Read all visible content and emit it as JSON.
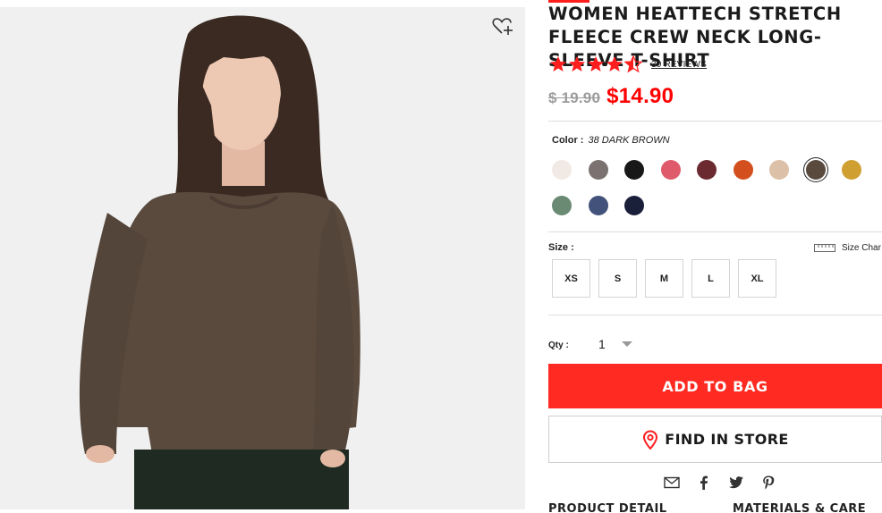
{
  "product": {
    "title": "WOMEN HEATTECH STRETCH FLEECE CREW NECK LONG-SLEEVE T-SHIRT",
    "rating": 4.5,
    "reviews_label": "30 REVIEWS",
    "original_price": "$ 19.90",
    "sale_price": "$14.90"
  },
  "color": {
    "label": "Color :",
    "selected_name": "38 DARK BROWN",
    "swatches": [
      {
        "hex": "#f1e9e4"
      },
      {
        "hex": "#7a7170"
      },
      {
        "hex": "#181818"
      },
      {
        "hex": "#df5b6b"
      },
      {
        "hex": "#6a2a30"
      },
      {
        "hex": "#d3501e"
      },
      {
        "hex": "#dcc0a8"
      },
      {
        "hex": "#5a4a3e",
        "selected": true
      },
      {
        "hex": "#cfa031"
      },
      {
        "hex": "#6a8a74"
      },
      {
        "hex": "#42527a"
      },
      {
        "hex": "#1a1f3a"
      }
    ]
  },
  "size": {
    "label": "Size :",
    "chart_label": "Size Char",
    "options": [
      "XS",
      "S",
      "M",
      "L",
      "XL"
    ]
  },
  "quantity": {
    "label": "Qty :",
    "value": "1"
  },
  "actions": {
    "add_to_bag": "ADD TO BAG",
    "find_in_store": "FIND IN STORE"
  },
  "tabs": {
    "product_detail": "PRODUCT DETAIL",
    "materials_care": "MATERIALS & CARE"
  },
  "icons": {
    "favorite": "heart-plus-icon",
    "share": [
      "email-icon",
      "facebook-icon",
      "twitter-icon",
      "pinterest-icon"
    ],
    "store": "location-pin-icon",
    "size_chart": "ruler-icon"
  },
  "colors": {
    "accent": "#ff2b22",
    "price_red": "#ff0000",
    "star": "#ff1e1e"
  }
}
